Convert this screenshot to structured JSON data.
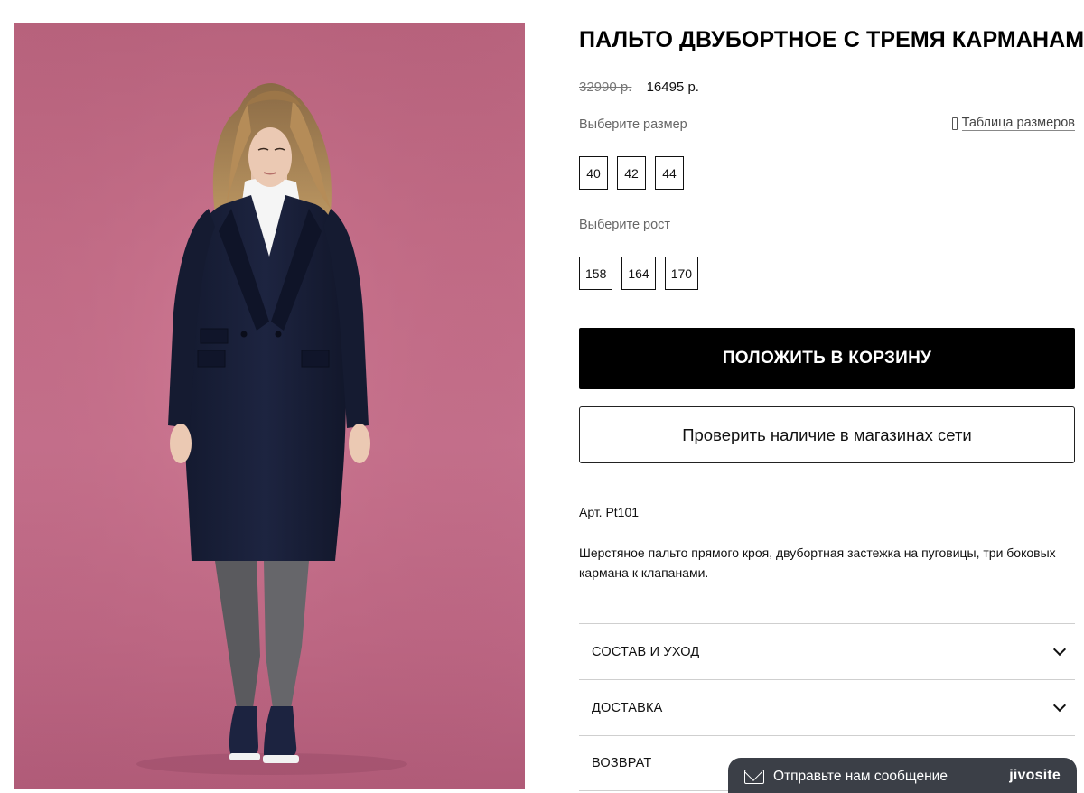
{
  "product": {
    "title": "ПАЛЬТО ДВУБОРТНОЕ С ТРЕМЯ КАРМАНАМИ",
    "old_price": "32990 р.",
    "new_price": "16495 р.",
    "size_label": "Выберите размер",
    "size_table_link": "Таблица размеров",
    "sizes": [
      "40",
      "42",
      "44"
    ],
    "height_label": "Выберите рост",
    "heights": [
      "158",
      "164",
      "170"
    ],
    "add_to_cart": "ПОЛОЖИТЬ В КОРЗИНУ",
    "check_availability": "Проверить наличие в магазинах сети",
    "article": "Арт. Pt101",
    "description": "Шерстяное пальто прямого кроя, двубортная застежка на пуговицы, три боковых кармана к клапанами."
  },
  "accordion": [
    {
      "label": "СОСТАВ И УХОД",
      "icon": "chevron-down-icon"
    },
    {
      "label": "ДОСТАВКА",
      "icon": "chevron-down-icon"
    },
    {
      "label": "ВОЗВРАТ",
      "icon": "chevron-down-icon"
    }
  ],
  "chat_widget": {
    "message": "Отправьте нам сообщение",
    "brand": "jivosite",
    "icon": "mail-icon",
    "bg_color": "#3b3f47"
  },
  "colors": {
    "photo_background": "#c4708a",
    "coat": "#1a2038",
    "cart_button": "#000000"
  }
}
